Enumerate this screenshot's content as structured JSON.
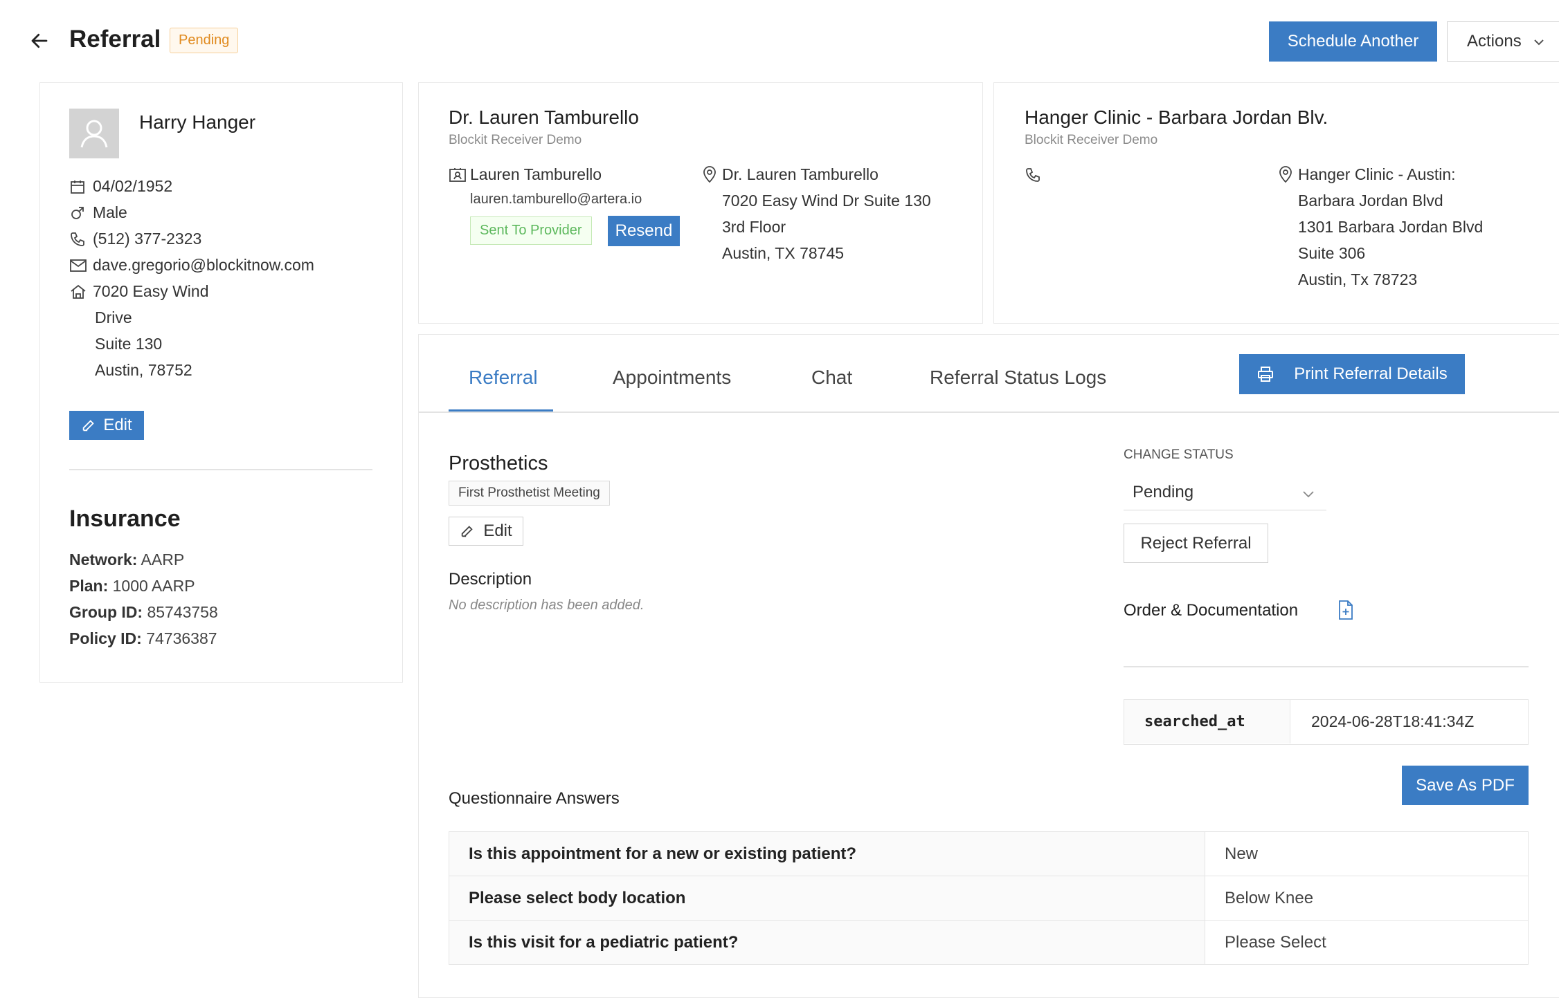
{
  "header": {
    "title": "Referral",
    "status_badge": "Pending",
    "schedule_another_label": "Schedule Another",
    "actions_label": "Actions"
  },
  "patient": {
    "name": "Harry Hanger",
    "dob": "04/02/1952",
    "gender": "Male",
    "phone": "(512) 377-2323",
    "email": "dave.gregorio@blockitnow.com",
    "address_lines": [
      "7020 Easy Wind",
      "Drive",
      "Suite 130",
      "Austin, 78752"
    ],
    "edit_label": "Edit",
    "insurance": {
      "heading": "Insurance",
      "network_label": "Network:",
      "network": "AARP",
      "plan_label": "Plan:",
      "plan": "1000 AARP",
      "group_label": "Group ID:",
      "group": "85743758",
      "policy_label": "Policy ID:",
      "policy": "74736387"
    }
  },
  "provider": {
    "name": "Dr. Lauren Tamburello",
    "org": "Blockit Receiver Demo",
    "contact_name": "Lauren Tamburello",
    "contact_email": "lauren.tamburello@artera.io",
    "sent_badge": "Sent To Provider",
    "resend_label": "Resend",
    "address_lines": [
      "Dr. Lauren Tamburello",
      "7020 Easy Wind Dr Suite 130",
      "3rd Floor",
      "Austin, TX 78745"
    ]
  },
  "clinic": {
    "name": "Hanger Clinic - Barbara Jordan Blv.",
    "org": "Blockit Receiver Demo",
    "address_lines": [
      "Hanger Clinic - Austin:",
      "Barbara Jordan Blvd",
      "1301 Barbara Jordan Blvd",
      "Suite 306",
      "Austin, Tx 78723"
    ]
  },
  "tabs": [
    {
      "label": "Referral",
      "active": true
    },
    {
      "label": "Appointments",
      "active": false
    },
    {
      "label": "Chat",
      "active": false
    },
    {
      "label": "Referral Status Logs",
      "active": false
    }
  ],
  "print_label": "Print Referral Details",
  "referral": {
    "specialty": "Prosthetics",
    "visit_type_tag": "First Prosthetist Meeting",
    "edit_label": "Edit",
    "description_label": "Description",
    "description_empty": "No description has been added."
  },
  "status": {
    "change_status_label": "CHANGE STATUS",
    "selected": "Pending",
    "reject_label": "Reject Referral",
    "order_doc_label": "Order & Documentation"
  },
  "meta": {
    "key": "searched_at",
    "value": "2024-06-28T18:41:34Z"
  },
  "save_pdf_label": "Save As PDF",
  "questionnaire": {
    "heading": "Questionnaire Answers",
    "rows": [
      {
        "q": "Is this appointment for a new or existing patient?",
        "a": "New"
      },
      {
        "q": "Please select body location",
        "a": "Below Knee"
      },
      {
        "q": "Is this visit for a pediatric patient?",
        "a": "Please Select"
      }
    ]
  },
  "colors": {
    "accent": "#3b7cc4",
    "pending": "#e08a1e",
    "success": "#5cb85c"
  }
}
